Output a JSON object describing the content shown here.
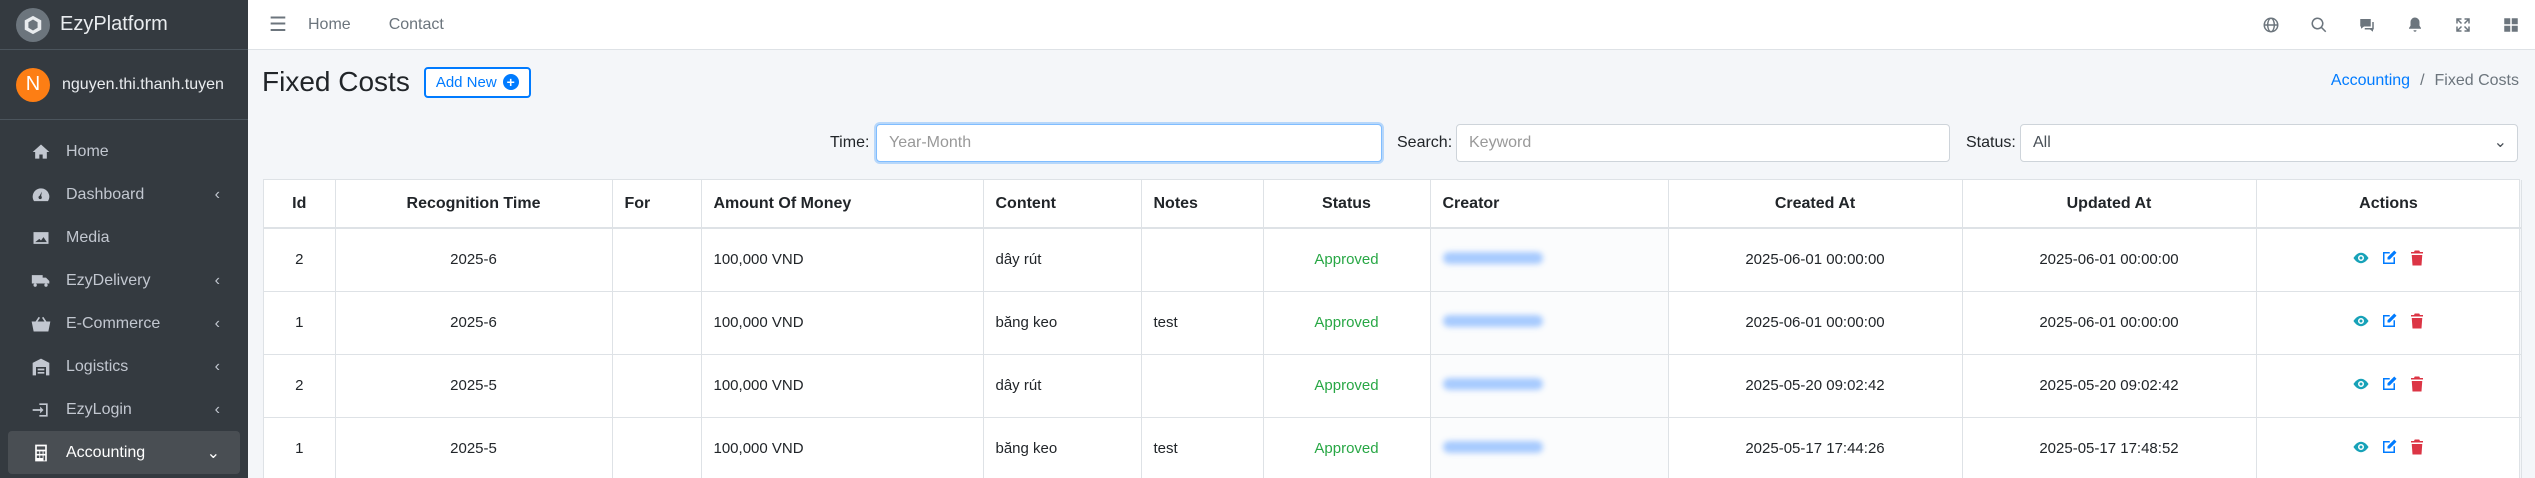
{
  "brand": {
    "name": "EzyPlatform"
  },
  "user": {
    "initial": "N",
    "name": "nguyen.thi.thanh.tuyen"
  },
  "sidebar": {
    "items": [
      {
        "label": "Home",
        "icon": "home-icon",
        "caret": ""
      },
      {
        "label": "Dashboard",
        "icon": "dashboard-icon",
        "caret": "‹"
      },
      {
        "label": "Media",
        "icon": "image-icon",
        "caret": ""
      },
      {
        "label": "EzyDelivery",
        "icon": "truck-icon",
        "caret": "‹"
      },
      {
        "label": "E-Commerce",
        "icon": "shopping-basket-icon",
        "caret": "‹"
      },
      {
        "label": "Logistics",
        "icon": "warehouse-icon",
        "caret": "‹"
      },
      {
        "label": "EzyLogin",
        "icon": "sign-in-icon",
        "caret": "‹"
      },
      {
        "label": "Accounting",
        "icon": "calculator-icon",
        "caret": "⌄"
      }
    ]
  },
  "topbar": {
    "links": [
      "Home",
      "Contact"
    ],
    "icons": [
      "globe-icon",
      "search-icon",
      "comments-icon",
      "bell-icon",
      "expand-icon",
      "grid-icon"
    ]
  },
  "header": {
    "title": "Fixed Costs",
    "add_label": "Add New",
    "breadcrumb": {
      "parent": "Accounting",
      "separator": "/",
      "current": "Fixed Costs"
    }
  },
  "filter": {
    "time_label": "Time:",
    "time_placeholder": "Year-Month",
    "search_label": "Search:",
    "search_placeholder": "Keyword",
    "status_label": "Status:",
    "status_value": "All"
  },
  "table": {
    "columns": [
      "Id",
      "Recognition Time",
      "For",
      "Amount Of Money",
      "Content",
      "Notes",
      "Status",
      "Creator",
      "Created At",
      "Updated At",
      "Actions"
    ],
    "rows": [
      {
        "id": "2",
        "time": "2025-6",
        "for": "",
        "amount": "100,000 VND",
        "content": "dây rút",
        "notes": "",
        "status": "Approved",
        "created": "2025-06-01 00:00:00",
        "updated": "2025-06-01 00:00:00"
      },
      {
        "id": "1",
        "time": "2025-6",
        "for": "",
        "amount": "100,000 VND",
        "content": "băng keo",
        "notes": "test",
        "status": "Approved",
        "created": "2025-06-01 00:00:00",
        "updated": "2025-06-01 00:00:00"
      },
      {
        "id": "2",
        "time": "2025-5",
        "for": "",
        "amount": "100,000 VND",
        "content": "dây rút",
        "notes": "",
        "status": "Approved",
        "created": "2025-05-20 09:02:42",
        "updated": "2025-05-20 09:02:42"
      },
      {
        "id": "1",
        "time": "2025-5",
        "for": "",
        "amount": "100,000 VND",
        "content": "băng keo",
        "notes": "test",
        "status": "Approved",
        "created": "2025-05-17 17:44:26",
        "updated": "2025-05-17 17:48:52"
      }
    ]
  },
  "colors": {
    "primary": "#007bff",
    "approved": "#28a745",
    "danger": "#dc3545",
    "view": "#17a2b8",
    "sidebar": "#343a40"
  }
}
